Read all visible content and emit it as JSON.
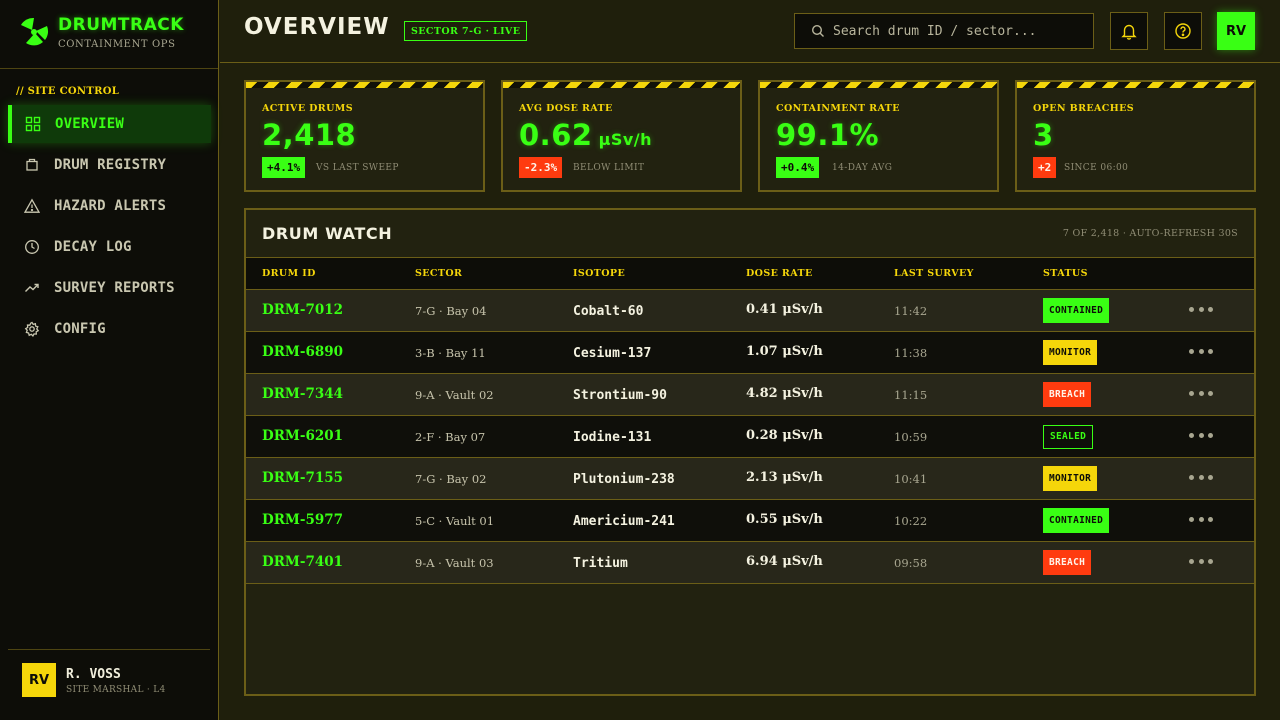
{
  "brand": {
    "name": "DRUMTRACK",
    "subtitle": "CONTAINMENT OPS"
  },
  "sidebar": {
    "section_label": "// SITE CONTROL",
    "items": [
      {
        "label": "OVERVIEW",
        "icon": "grid-icon",
        "active": true
      },
      {
        "label": "DRUM REGISTRY",
        "icon": "barrel-icon",
        "active": false
      },
      {
        "label": "HAZARD ALERTS",
        "icon": "warning-triangle-icon",
        "active": false
      },
      {
        "label": "DECAY LOG",
        "icon": "clock-icon",
        "active": false
      },
      {
        "label": "SURVEY REPORTS",
        "icon": "trend-up-icon",
        "active": false
      },
      {
        "label": "CONFIG",
        "icon": "gear-icon",
        "active": false
      }
    ],
    "user": {
      "initials": "RV",
      "name": "R. VOSS",
      "role": "SITE MARSHAL · L4"
    }
  },
  "header": {
    "title": "OVERVIEW",
    "sector_badge": "SECTOR 7-G · LIVE",
    "search_placeholder": "Search drum ID / sector...",
    "avatar_initials": "RV"
  },
  "kpis": [
    {
      "label": "ACTIVE DRUMS",
      "value": "2,418",
      "unit": "",
      "delta": "+4.1%",
      "delta_dir": "up",
      "note": "VS LAST SWEEP"
    },
    {
      "label": "AVG DOSE RATE",
      "value": "0.62",
      "unit": "μSv/h",
      "delta": "-2.3%",
      "delta_dir": "down",
      "note": "BELOW LIMIT"
    },
    {
      "label": "CONTAINMENT RATE",
      "value": "99.1%",
      "unit": "",
      "delta": "+0.4%",
      "delta_dir": "up",
      "note": "14-DAY AVG"
    },
    {
      "label": "OPEN BREACHES",
      "value": "3",
      "unit": "",
      "delta": "+2",
      "delta_dir": "down",
      "note": "SINCE 06:00"
    }
  ],
  "drum_watch": {
    "title": "DRUM WATCH",
    "meta": "7 OF 2,418 · AUTO-REFRESH 30S",
    "columns": [
      "DRUM ID",
      "SECTOR",
      "ISOTOPE",
      "DOSE RATE",
      "LAST SURVEY",
      "STATUS"
    ],
    "rows": [
      {
        "id": "DRM-7012",
        "sector": "7-G · Bay 04",
        "isotope": "Cobalt-60",
        "dose": "0.41 μSv/h",
        "time": "11:42",
        "status": "CONTAINED"
      },
      {
        "id": "DRM-6890",
        "sector": "3-B · Bay 11",
        "isotope": "Cesium-137",
        "dose": "1.07 μSv/h",
        "time": "11:38",
        "status": "MONITOR"
      },
      {
        "id": "DRM-7344",
        "sector": "9-A · Vault 02",
        "isotope": "Strontium-90",
        "dose": "4.82 μSv/h",
        "time": "11:15",
        "status": "BREACH"
      },
      {
        "id": "DRM-6201",
        "sector": "2-F · Bay 07",
        "isotope": "Iodine-131",
        "dose": "0.28 μSv/h",
        "time": "10:59",
        "status": "SEALED"
      },
      {
        "id": "DRM-7155",
        "sector": "7-G · Bay 02",
        "isotope": "Plutonium-238",
        "dose": "2.13 μSv/h",
        "time": "10:41",
        "status": "MONITOR"
      },
      {
        "id": "DRM-5977",
        "sector": "5-C · Vault 01",
        "isotope": "Americium-241",
        "dose": "0.55 μSv/h",
        "time": "10:22",
        "status": "CONTAINED"
      },
      {
        "id": "DRM-7401",
        "sector": "9-A · Vault 03",
        "isotope": "Tritium",
        "dose": "6.94 μSv/h",
        "time": "09:58",
        "status": "BREACH"
      }
    ]
  },
  "colors": {
    "accent_green": "#39ff14",
    "hazard_yellow": "#f5d60a",
    "alert_red": "#ff3b0f",
    "border_olive": "#6b5e17",
    "background": "#1f1f0c"
  }
}
